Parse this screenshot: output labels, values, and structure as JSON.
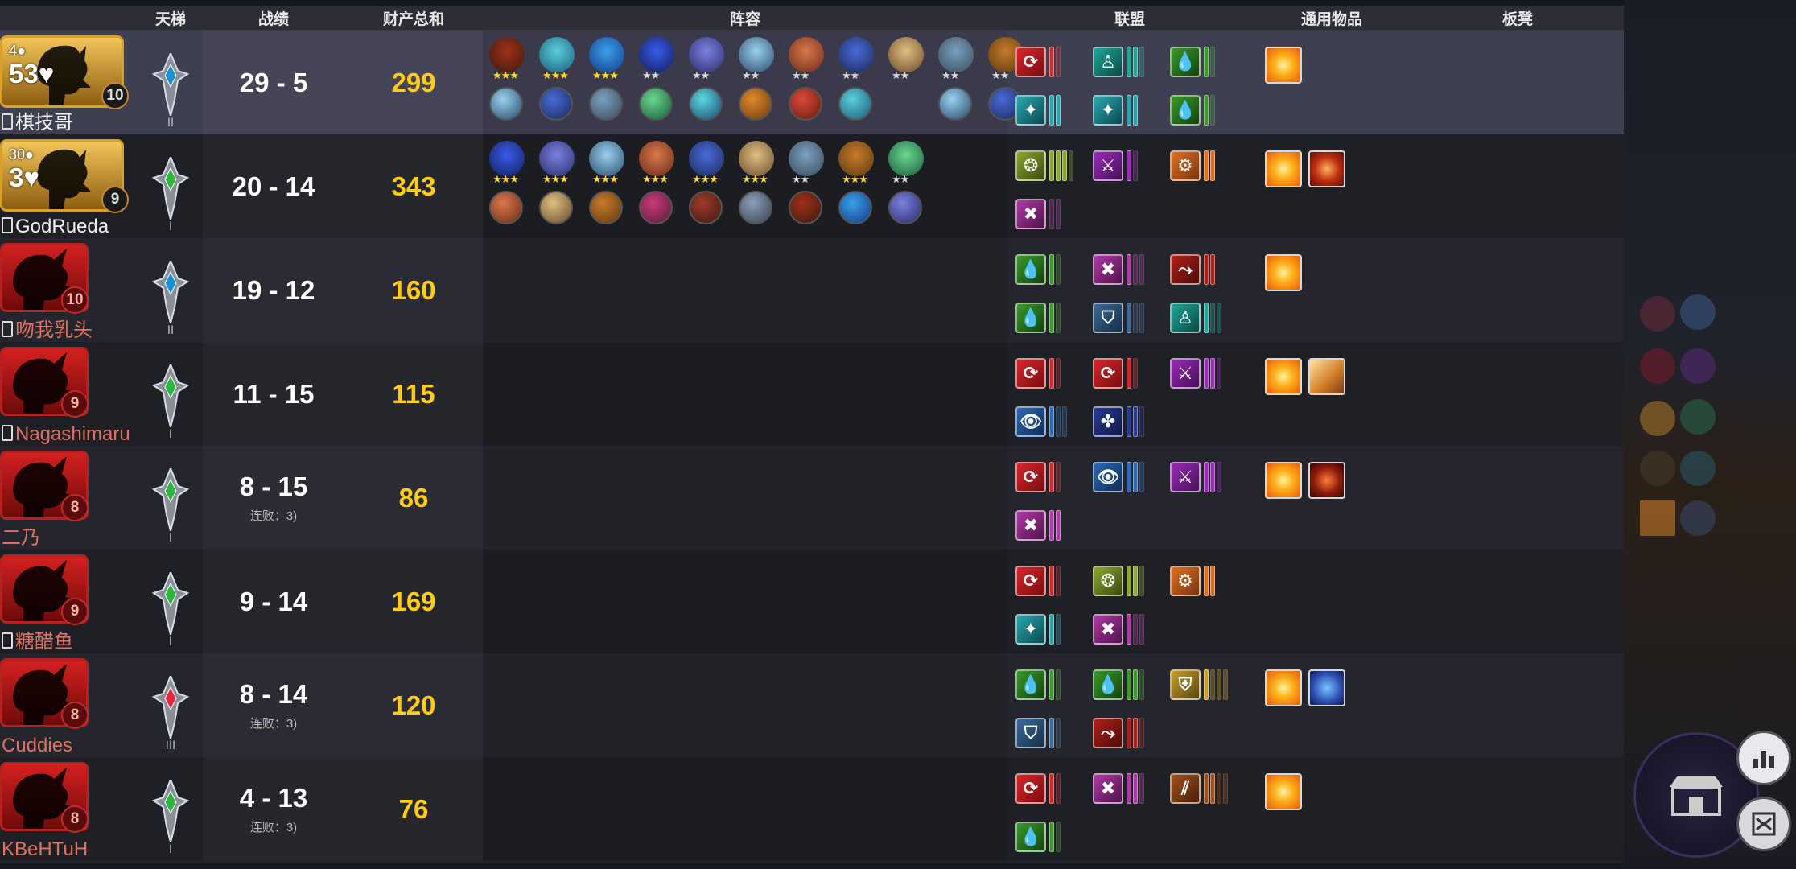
{
  "headers": {
    "ladder": "天梯",
    "record": "战绩",
    "net": "财产总和",
    "lineup": "阵容",
    "alliance": "联盟",
    "items": "通用物品",
    "bench": "板凳"
  },
  "players": [
    {
      "name": "棋技哥",
      "hp": "53",
      "gold": "4",
      "level": "10",
      "record": "29 - 5",
      "streak": "",
      "net": "299",
      "tier": "II",
      "me": true
    },
    {
      "name": "GodRueda",
      "hp": "3",
      "gold": "30",
      "level": "9",
      "record": "20 - 14",
      "streak": "",
      "net": "343",
      "tier": "I",
      "me": false
    },
    {
      "name": "吻我乳头",
      "hp": "",
      "gold": "",
      "level": "10",
      "record": "19 - 12",
      "streak": "",
      "net": "160",
      "tier": "II",
      "me": false
    },
    {
      "name": "Nagashimaru",
      "hp": "",
      "gold": "",
      "level": "9",
      "record": "11 - 15",
      "streak": "",
      "net": "115",
      "tier": "I",
      "me": false
    },
    {
      "name": "二乃",
      "hp": "",
      "gold": "",
      "level": "8",
      "record": "8 - 15",
      "streak": "连败：3)",
      "net": "86",
      "tier": "I",
      "me": false
    },
    {
      "name": "糖醋鱼",
      "hp": "",
      "gold": "",
      "level": "9",
      "record": "9 - 14",
      "streak": "",
      "net": "169",
      "tier": "I",
      "me": false
    },
    {
      "name": "Cuddies",
      "hp": "",
      "gold": "",
      "level": "8",
      "record": "8 - 14",
      "streak": "连败：3)",
      "net": "120",
      "tier": "III",
      "me": false
    },
    {
      "name": "KBeHTuH",
      "hp": "",
      "gold": "",
      "level": "8",
      "record": "4 - 13",
      "streak": "连败：3)",
      "net": "76",
      "tier": "I",
      "me": false
    }
  ],
  "colors": {
    "net_gold": "#ffcc14",
    "row_me": "#3f3f52",
    "header": "#2c2d35"
  }
}
